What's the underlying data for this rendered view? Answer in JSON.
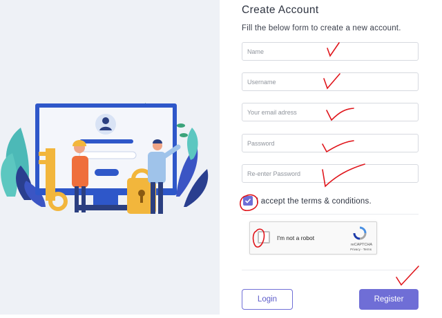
{
  "form": {
    "title": "Create Account",
    "subtitle": "Fill the below form to create a new account.",
    "fields": {
      "name_placeholder": "Name",
      "username_placeholder": "Username",
      "email_placeholder": "Your email adress",
      "password_placeholder": "Password",
      "reenter_placeholder": "Re-enter Password"
    },
    "terms_label": "I accept the terms & conditions.",
    "terms_checked": true,
    "login_label": "Login",
    "register_label": "Register"
  },
  "recaptcha": {
    "label": "I'm not a robot",
    "brand": "reCAPTCHA",
    "links": "Privacy - Terms"
  },
  "colors": {
    "accent": "#6f6ed6",
    "panel_bg": "#eef1f6",
    "annotation": "#e0151b"
  }
}
